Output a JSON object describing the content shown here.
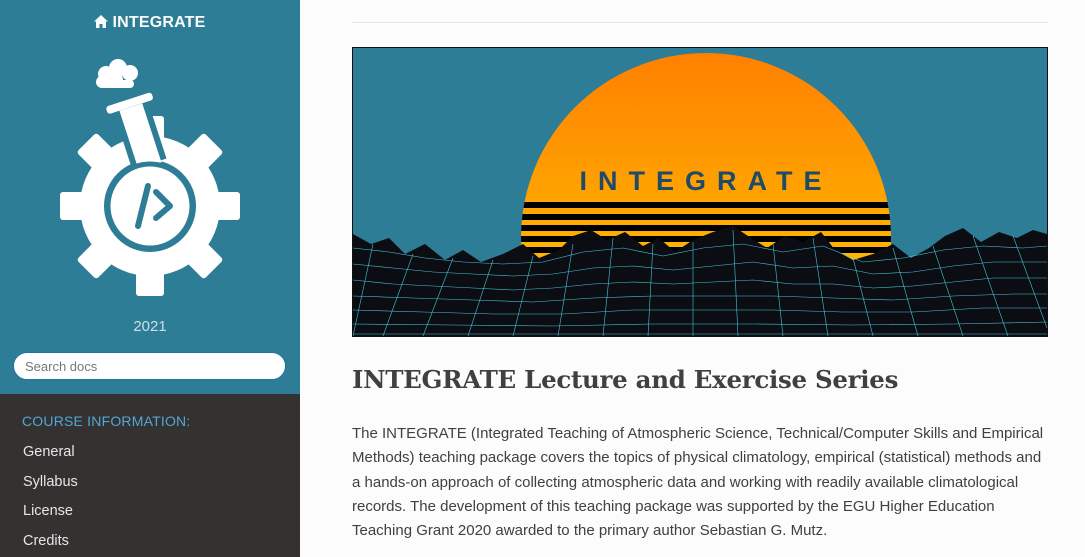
{
  "sidebar": {
    "project_name": "INTEGRATE",
    "version": "2021",
    "search": {
      "placeholder": "Search docs",
      "value": ""
    },
    "caption": "COURSE INFORMATION:",
    "items": [
      {
        "label": "General"
      },
      {
        "label": "Syllabus"
      },
      {
        "label": "License"
      },
      {
        "label": "Credits"
      }
    ]
  },
  "banner": {
    "text": "INTEGRATE",
    "colors": {
      "sky": "#2e7d96",
      "sun_top": "#ff8c00",
      "sun_bottom": "#ffd400",
      "mesh": "#4fd8f0"
    }
  },
  "main": {
    "title": "INTEGRATE Lecture and Exercise Series",
    "intro": "The INTEGRATE (Integrated Teaching of Atmospheric Science, Technical/Computer Skills and Empirical Methods) teaching package covers the topics of physical climatology, empirical (statistical) methods and a hands-on approach of collecting atmospheric data and working with readily available climatological records. The development of this teaching package was supported by the EGU Higher Education Teaching Grant 2020 awarded to the primary author Sebastian G. Mutz."
  },
  "colors": {
    "sidebar_top": "#2e7d96",
    "sidebar_dark": "#343131",
    "caption": "#55a5d9",
    "text": "#404040"
  },
  "icons": [
    "home-icon",
    "integrate-logo",
    "flask-gear-icon"
  ]
}
